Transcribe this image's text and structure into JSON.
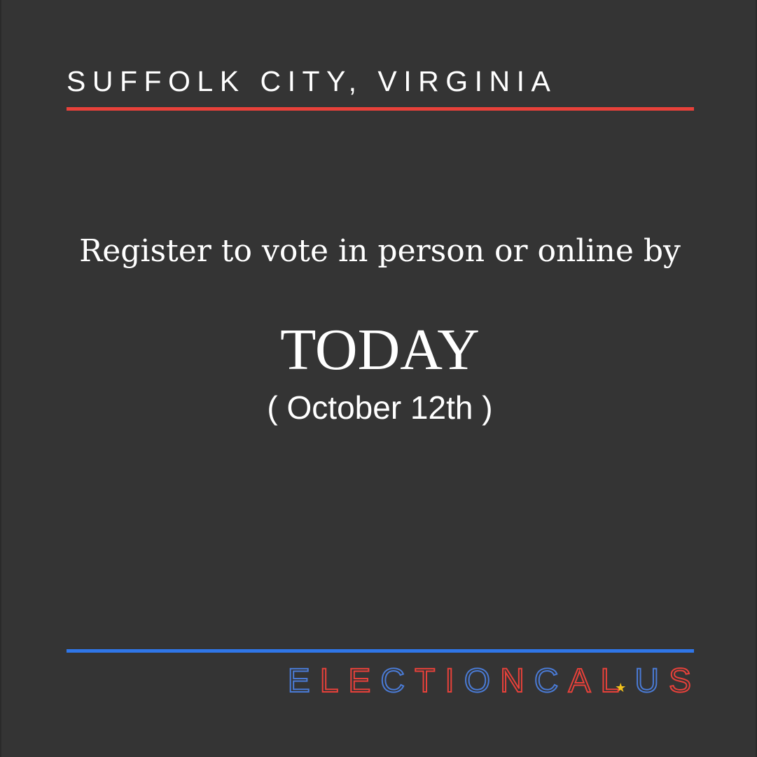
{
  "header": {
    "location": "SUFFOLK CITY, VIRGINIA"
  },
  "message": {
    "line": "Register to vote in person or online by",
    "deadline": "TODAY",
    "date": "( October 12th )"
  },
  "brand": {
    "text": "ELECTIONCAL.US",
    "part1": "ELECTIONCAL",
    "part2": "US",
    "star_icon": "star-icon",
    "colors": {
      "red": "#e8413a",
      "blue": "#2f76e8",
      "star": "#f2c21b"
    }
  },
  "colors": {
    "background": "#343434",
    "top_rule": "#e8413a",
    "bottom_rule": "#2f76e8",
    "text": "#ffffff"
  }
}
